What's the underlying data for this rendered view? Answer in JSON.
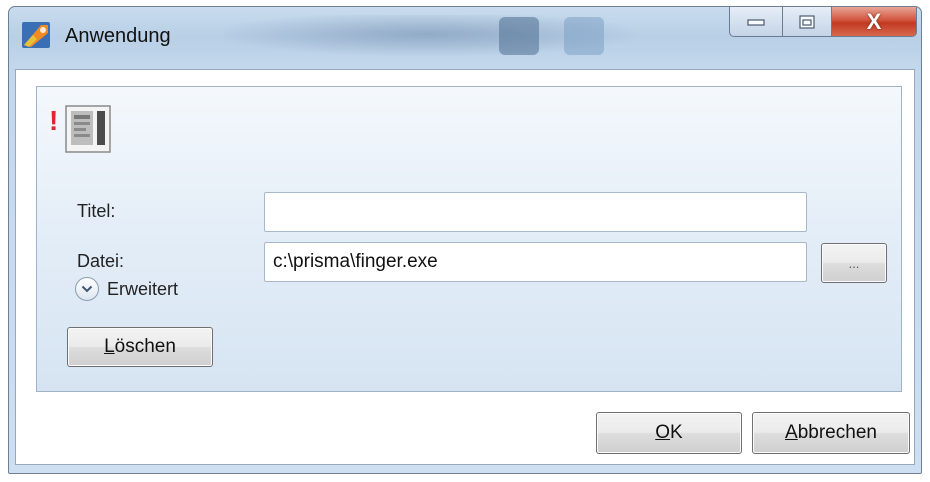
{
  "window": {
    "title": "Anwendung",
    "close_glyph": "X"
  },
  "form": {
    "title_label": "Titel:",
    "title_value": "",
    "file_label": "Datei:",
    "file_value": "c:\\prisma\\finger.exe",
    "browse_label": "...",
    "advanced_label": "Erweitert",
    "delete_label_accel": "L",
    "delete_label_rest": "öschen"
  },
  "footer": {
    "ok_accel": "O",
    "ok_rest": "K",
    "cancel_accel": "A",
    "cancel_rest": "bbrechen"
  },
  "icons": {
    "app": "paint-app-icon",
    "warning": "exclamation-icon",
    "thumbnail": "application-document-icon",
    "expander": "chevron-down-icon"
  }
}
